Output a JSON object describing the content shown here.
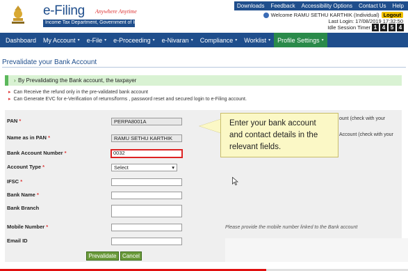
{
  "header": {
    "logo_title": "e-Filing",
    "logo_tagline": "Anywhere Anytime",
    "logo_subtitle": "Income Tax Department, Government of India",
    "top_links": [
      "Downloads",
      "Feedback",
      "Accessibility Options",
      "Contact Us",
      "Help"
    ],
    "welcome_text": "Welcome RAMU SETHU KARTHIK (Individual)",
    "logout_label": "Logout",
    "last_login": "Last Login: 17/08/2019 17:32:50",
    "idle_label": "Idle Session Timer",
    "idle_digits": [
      "1",
      "4",
      "5",
      "4"
    ]
  },
  "nav": {
    "items": [
      {
        "label": "Dashboard",
        "caret": false
      },
      {
        "label": "My Account",
        "caret": true
      },
      {
        "label": "e-File",
        "caret": true
      },
      {
        "label": "e-Proceeding",
        "caret": true
      },
      {
        "label": "e-Nivaran",
        "caret": true
      },
      {
        "label": "Compliance",
        "caret": true
      },
      {
        "label": "Worklist",
        "caret": true
      },
      {
        "label": "Profile Settings",
        "caret": true
      }
    ],
    "active_index": 7
  },
  "page": {
    "title": "Prevalidate your Bank Account",
    "banner": "By Prevalidating the Bank account, the taxpayer",
    "bullets": [
      "Can Receive the refund only in the pre-validated bank account",
      "Can Generate EVC for e-Verification of returns/forms , password reset and secured login to e-Filing account."
    ]
  },
  "form": {
    "pan_label": "PAN",
    "pan_value": "PERPA8001A",
    "name_label": "Name as in PAN",
    "name_value": "RAMU SETHU KARTHIK",
    "account_label": "Bank Account Number",
    "account_value": "0032",
    "type_label": "Account Type",
    "type_value": "Select",
    "ifsc_label": "IFSC",
    "ifsc_value": "",
    "bank_name_label": "Bank Name",
    "bank_branch_label": "Bank Branch",
    "mobile_label": "Mobile Number",
    "email_label": "Email ID",
    "hint_1": "ount (check with your",
    "hint_2": "Account (check with your",
    "mobile_hint": "Please provide the mobile number linked to the Bank account",
    "prevalidate_label": "Prevalidate",
    "cancel_label": "Cancel",
    "required_mark": "*"
  },
  "callout": {
    "text": "Enter your bank account and contact details in the relevant fields."
  },
  "colors": {
    "brand_blue": "#1f4e8c",
    "active_green": "#2a8a4a",
    "error_red": "#d22"
  }
}
